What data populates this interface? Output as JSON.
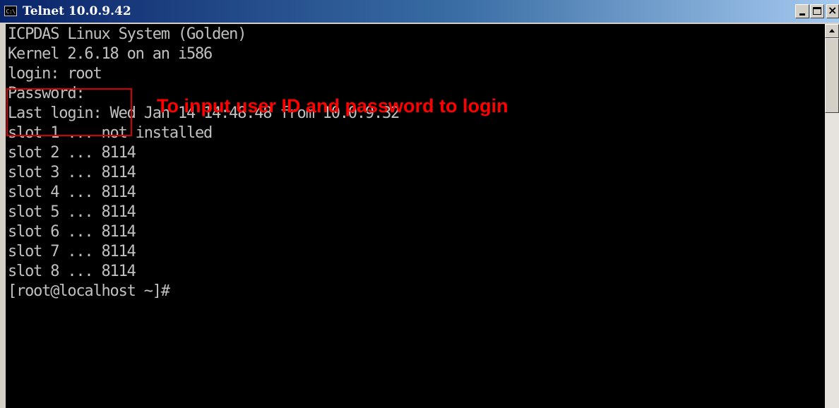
{
  "window": {
    "title": "Telnet 10.0.9.42",
    "icon": "console-app-icon",
    "icon_label": "C:\\",
    "buttons": {
      "minimize": "minimize-icon",
      "maximize": "maximize-icon",
      "close": "close-icon",
      "close_glyph": "×"
    }
  },
  "console": {
    "lines": [
      "ICPDAS Linux System (Golden)",
      "Kernel 2.6.18 on an i586",
      "login: root",
      "Password:",
      "Last login: Wed Jan 14 14:48:48 from 10.0.9.32",
      "slot 1 ... not installed",
      "slot 2 ... 8114",
      "slot 3 ... 8114",
      "slot 4 ... 8114",
      "slot 5 ... 8114",
      "slot 6 ... 8114",
      "slot 7 ... 8114",
      "slot 8 ... 8114",
      "[root@localhost ~]#"
    ]
  },
  "annotation": {
    "text": "To input user ID and password to login",
    "color": "#ff0000"
  },
  "colors": {
    "console_background": "#000000",
    "console_text": "#c0c0c0",
    "titlebar_start": "#0a246a",
    "titlebar_end": "#a6caf0"
  }
}
